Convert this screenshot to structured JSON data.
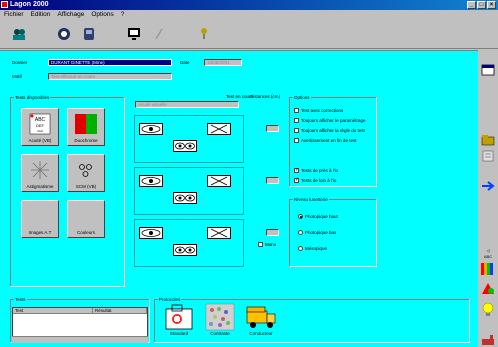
{
  "window": {
    "title": "Lagon 2000",
    "minimize": "_",
    "maximize": "□",
    "close": "×"
  },
  "menu": [
    "Fichier",
    "Edition",
    "Affichage",
    "Options",
    "?"
  ],
  "toolbar": {
    "icons": [
      "people-icon",
      "record-icon",
      "phone-icon",
      "monitor-icon",
      "pen-icon",
      "pin-icon"
    ]
  },
  "form": {
    "dossier_label": "Dossier",
    "dossier_value": "DURANT GINETTE (Mme)",
    "date_label": "Date",
    "date_value": "15/08/2001",
    "motif_label": "Motif",
    "motif_value": "Test effectué en cours"
  },
  "tests": {
    "title": "Tests disponibles",
    "buttons": [
      {
        "label": "Acuité (VB)"
      },
      {
        "label": "Duochrome"
      },
      {
        "label": "Astigmatisme"
      },
      {
        "label": "SCM (VB)"
      },
      {
        "label": "Images A.T"
      },
      {
        "label": "Couleurs"
      }
    ]
  },
  "current": {
    "label": "Test en cours",
    "value": "Acuité visuelle",
    "distance_label": "Distances (cm)",
    "mono_label": "Mono"
  },
  "options": {
    "title": "Options",
    "items": [
      {
        "label": "Test avec corrections",
        "checked": false
      },
      {
        "label": "Toujours afficher le paramétrage",
        "checked": false
      },
      {
        "label": "Toujours afficher la règle du test",
        "checked": false
      },
      {
        "label": "Avertissement en fin de test",
        "checked": false
      },
      {
        "label": "Tests de près à l'io",
        "checked": true
      },
      {
        "label": "Tests de loin à l'io",
        "checked": true
      }
    ]
  },
  "niveau": {
    "title": "Niveau lunetterie",
    "items": [
      {
        "label": "Photopique haut",
        "selected": true
      },
      {
        "label": "Photopique bas",
        "selected": false
      },
      {
        "label": "Mésopique",
        "selected": false
      }
    ]
  },
  "tests_list": {
    "title": "Tests",
    "columns": [
      "Test",
      "Résultat"
    ],
    "rows": []
  },
  "protocols": {
    "title": "Protocoles",
    "items": [
      {
        "label": "Standard"
      },
      {
        "label": "Contraste"
      },
      {
        "label": "Conducteur"
      }
    ]
  },
  "colors": {
    "bg": "#00ffff",
    "title": "#000080",
    "selected": "#000080"
  }
}
